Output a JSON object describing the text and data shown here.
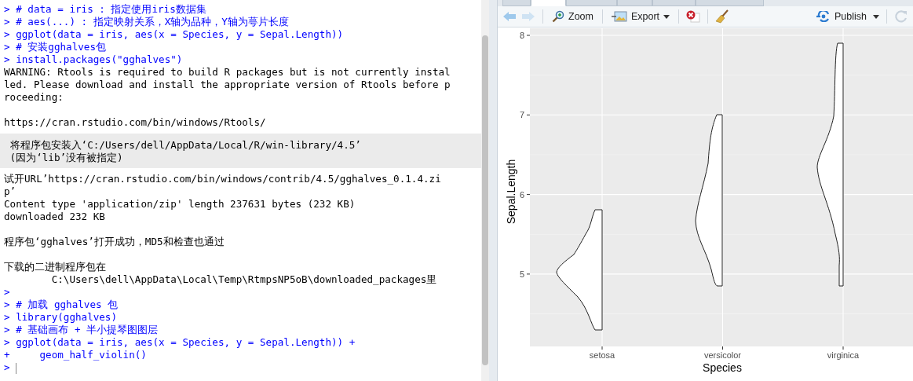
{
  "console": {
    "lines": [
      {
        "kind": "input",
        "prompt": ">",
        "text": "# data = iris : 指定使用iris数据集"
      },
      {
        "kind": "input",
        "prompt": ">",
        "text": "# aes(...) : 指定映射关系，X轴为品种，Y轴为萼片长度"
      },
      {
        "kind": "input",
        "prompt": ">",
        "text": "ggplot(data = iris, aes(x = Species, y = Sepal.Length))"
      },
      {
        "kind": "input",
        "prompt": ">",
        "text": "# 安装gghalves包"
      },
      {
        "kind": "input",
        "prompt": ">",
        "text": "install.packages(\"gghalves\")"
      },
      {
        "kind": "output",
        "text": "WARNING: Rtools is required to build R packages but is not currently instal"
      },
      {
        "kind": "output",
        "text": "led. Please download and install the appropriate version of Rtools before p"
      },
      {
        "kind": "output",
        "text": "roceeding:"
      },
      {
        "kind": "blank"
      },
      {
        "kind": "output",
        "text": "https://cran.rstudio.com/bin/windows/Rtools/"
      },
      {
        "kind": "message",
        "lines": [
          " 将程序包安装入‘C:/Users/dell/AppData/Local/R/win-library/4.5’",
          " (因为‘lib’没有被指定)"
        ]
      },
      {
        "kind": "output",
        "text": "试开URL’https://cran.rstudio.com/bin/windows/contrib/4.5/gghalves_0.1.4.zi"
      },
      {
        "kind": "output",
        "text": "p’"
      },
      {
        "kind": "output",
        "text": "Content type 'application/zip' length 237631 bytes (232 KB)"
      },
      {
        "kind": "output",
        "text": "downloaded 232 KB"
      },
      {
        "kind": "blank"
      },
      {
        "kind": "output",
        "text": "程序包‘gghalves’打开成功，MD5和检查也通过"
      },
      {
        "kind": "blank"
      },
      {
        "kind": "output",
        "text": "下载的二进制程序包在"
      },
      {
        "kind": "output",
        "text": "        C:\\Users\\dell\\AppData\\Local\\Temp\\RtmpsNP5oB\\downloaded_packages里"
      },
      {
        "kind": "input",
        "prompt": ">"
      },
      {
        "kind": "input",
        "prompt": ">",
        "text": "# 加载 gghalves 包"
      },
      {
        "kind": "input",
        "prompt": ">",
        "text": "library(gghalves)"
      },
      {
        "kind": "input",
        "prompt": ">",
        "text": "# 基础画布 + 半小提琴图图层"
      },
      {
        "kind": "input",
        "prompt": ">",
        "text": "ggplot(data = iris, aes(x = Species, y = Sepal.Length)) +"
      },
      {
        "kind": "input",
        "prompt": "+",
        "text": "    geom_half_violin()"
      },
      {
        "kind": "input",
        "prompt": ">",
        "cursor": true
      }
    ]
  },
  "tabs": [
    {
      "selected": false
    },
    {
      "selected": true
    },
    {
      "selected": false
    },
    {
      "selected": false
    },
    {
      "selected": false
    },
    {
      "selected": false
    }
  ],
  "toolbar": {
    "zoom": "Zoom",
    "export": "Export",
    "publish": "Publish"
  },
  "plot": {
    "ylabel": "Sepal.Length",
    "xlabel": "Species",
    "yticks": [
      "8",
      "7",
      "6",
      "5"
    ],
    "categories": [
      "setosa",
      "versicolor",
      "virginica"
    ]
  }
}
